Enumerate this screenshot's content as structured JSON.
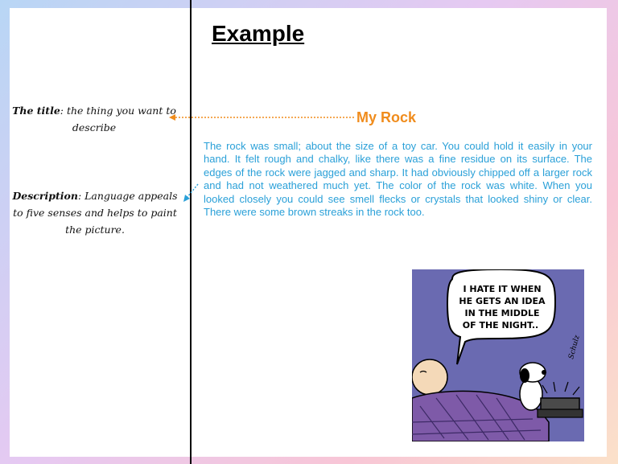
{
  "heading": "Example",
  "notes": {
    "title_label": "The title",
    "title_text": ": the thing you want to describe",
    "description_label": "Description",
    "description_text": ": Language appeals to five senses and helps to paint the picture."
  },
  "story": {
    "title": "My Rock",
    "body": "The rock was small; about the size of a toy car. You could hold it easily in your hand. It felt rough and chalky, like there was a fine residue on its surface. The edges of the rock were jagged and sharp. It had obviously chipped off a larger rock and had not weathered much yet. The color of the rock was white. When you looked closely you could see smell flecks or crystals that looked shiny or clear. There were some brown streaks in the rock too."
  },
  "comic": {
    "speech_line1": "I HATE IT WHEN",
    "speech_line2": "HE GETS AN IDEA",
    "speech_line3": "IN THE MIDDLE",
    "speech_line4": "OF THE NIGHT..",
    "signature": "Schulz"
  },
  "colors": {
    "accent_orange": "#f08c1c",
    "text_blue": "#2aa0d8",
    "comic_bg": "#6a6ab1"
  }
}
